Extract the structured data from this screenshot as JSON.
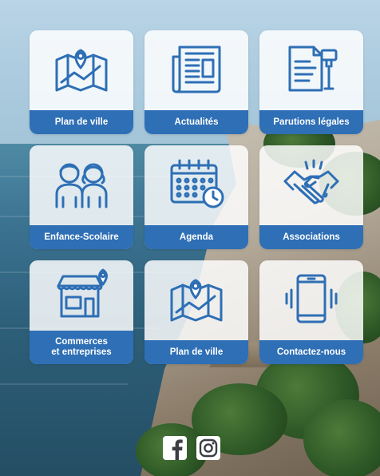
{
  "colors": {
    "tile_label_bg": "#2e6fb5",
    "icon_stroke": "#2e6fb5",
    "tile_bg": "rgba(255,255,255,0.84)"
  },
  "tiles": [
    {
      "label": "Plan de ville",
      "icon": "city-map-pin-icon"
    },
    {
      "label": "Actualités",
      "icon": "newspaper-icon"
    },
    {
      "label": "Parutions légales",
      "icon": "legal-document-gavel-icon"
    },
    {
      "label": "Enfance-Scolaire",
      "icon": "children-icon"
    },
    {
      "label": "Agenda",
      "icon": "calendar-clock-icon"
    },
    {
      "label": "Associations",
      "icon": "handshake-icon"
    },
    {
      "label": "Commerces\net entreprises",
      "icon": "storefront-pin-icon"
    },
    {
      "label": "Plan de ville",
      "icon": "city-map-pin-icon"
    },
    {
      "label": "Contactez-nous",
      "icon": "vibrating-tablet-icon"
    }
  ],
  "socials": [
    {
      "name": "facebook",
      "icon": "facebook-icon"
    },
    {
      "name": "instagram",
      "icon": "instagram-icon"
    }
  ]
}
